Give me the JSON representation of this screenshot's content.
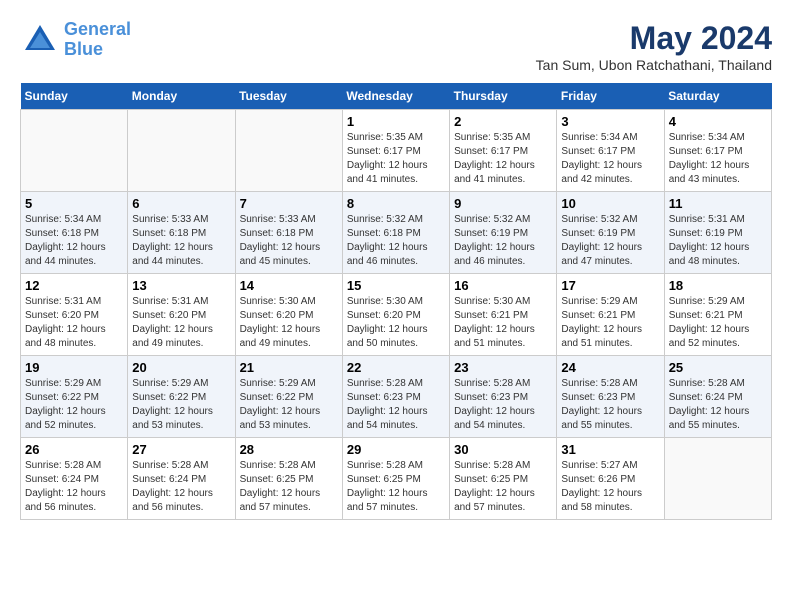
{
  "header": {
    "logo_line1": "General",
    "logo_line2": "Blue",
    "title": "May 2024",
    "subtitle": "Tan Sum, Ubon Ratchathani, Thailand"
  },
  "weekdays": [
    "Sunday",
    "Monday",
    "Tuesday",
    "Wednesday",
    "Thursday",
    "Friday",
    "Saturday"
  ],
  "weeks": [
    [
      {
        "day": "",
        "info": ""
      },
      {
        "day": "",
        "info": ""
      },
      {
        "day": "",
        "info": ""
      },
      {
        "day": "1",
        "info": "Sunrise: 5:35 AM\nSunset: 6:17 PM\nDaylight: 12 hours\nand 41 minutes."
      },
      {
        "day": "2",
        "info": "Sunrise: 5:35 AM\nSunset: 6:17 PM\nDaylight: 12 hours\nand 41 minutes."
      },
      {
        "day": "3",
        "info": "Sunrise: 5:34 AM\nSunset: 6:17 PM\nDaylight: 12 hours\nand 42 minutes."
      },
      {
        "day": "4",
        "info": "Sunrise: 5:34 AM\nSunset: 6:17 PM\nDaylight: 12 hours\nand 43 minutes."
      }
    ],
    [
      {
        "day": "5",
        "info": "Sunrise: 5:34 AM\nSunset: 6:18 PM\nDaylight: 12 hours\nand 44 minutes."
      },
      {
        "day": "6",
        "info": "Sunrise: 5:33 AM\nSunset: 6:18 PM\nDaylight: 12 hours\nand 44 minutes."
      },
      {
        "day": "7",
        "info": "Sunrise: 5:33 AM\nSunset: 6:18 PM\nDaylight: 12 hours\nand 45 minutes."
      },
      {
        "day": "8",
        "info": "Sunrise: 5:32 AM\nSunset: 6:18 PM\nDaylight: 12 hours\nand 46 minutes."
      },
      {
        "day": "9",
        "info": "Sunrise: 5:32 AM\nSunset: 6:19 PM\nDaylight: 12 hours\nand 46 minutes."
      },
      {
        "day": "10",
        "info": "Sunrise: 5:32 AM\nSunset: 6:19 PM\nDaylight: 12 hours\nand 47 minutes."
      },
      {
        "day": "11",
        "info": "Sunrise: 5:31 AM\nSunset: 6:19 PM\nDaylight: 12 hours\nand 48 minutes."
      }
    ],
    [
      {
        "day": "12",
        "info": "Sunrise: 5:31 AM\nSunset: 6:20 PM\nDaylight: 12 hours\nand 48 minutes."
      },
      {
        "day": "13",
        "info": "Sunrise: 5:31 AM\nSunset: 6:20 PM\nDaylight: 12 hours\nand 49 minutes."
      },
      {
        "day": "14",
        "info": "Sunrise: 5:30 AM\nSunset: 6:20 PM\nDaylight: 12 hours\nand 49 minutes."
      },
      {
        "day": "15",
        "info": "Sunrise: 5:30 AM\nSunset: 6:20 PM\nDaylight: 12 hours\nand 50 minutes."
      },
      {
        "day": "16",
        "info": "Sunrise: 5:30 AM\nSunset: 6:21 PM\nDaylight: 12 hours\nand 51 minutes."
      },
      {
        "day": "17",
        "info": "Sunrise: 5:29 AM\nSunset: 6:21 PM\nDaylight: 12 hours\nand 51 minutes."
      },
      {
        "day": "18",
        "info": "Sunrise: 5:29 AM\nSunset: 6:21 PM\nDaylight: 12 hours\nand 52 minutes."
      }
    ],
    [
      {
        "day": "19",
        "info": "Sunrise: 5:29 AM\nSunset: 6:22 PM\nDaylight: 12 hours\nand 52 minutes."
      },
      {
        "day": "20",
        "info": "Sunrise: 5:29 AM\nSunset: 6:22 PM\nDaylight: 12 hours\nand 53 minutes."
      },
      {
        "day": "21",
        "info": "Sunrise: 5:29 AM\nSunset: 6:22 PM\nDaylight: 12 hours\nand 53 minutes."
      },
      {
        "day": "22",
        "info": "Sunrise: 5:28 AM\nSunset: 6:23 PM\nDaylight: 12 hours\nand 54 minutes."
      },
      {
        "day": "23",
        "info": "Sunrise: 5:28 AM\nSunset: 6:23 PM\nDaylight: 12 hours\nand 54 minutes."
      },
      {
        "day": "24",
        "info": "Sunrise: 5:28 AM\nSunset: 6:23 PM\nDaylight: 12 hours\nand 55 minutes."
      },
      {
        "day": "25",
        "info": "Sunrise: 5:28 AM\nSunset: 6:24 PM\nDaylight: 12 hours\nand 55 minutes."
      }
    ],
    [
      {
        "day": "26",
        "info": "Sunrise: 5:28 AM\nSunset: 6:24 PM\nDaylight: 12 hours\nand 56 minutes."
      },
      {
        "day": "27",
        "info": "Sunrise: 5:28 AM\nSunset: 6:24 PM\nDaylight: 12 hours\nand 56 minutes."
      },
      {
        "day": "28",
        "info": "Sunrise: 5:28 AM\nSunset: 6:25 PM\nDaylight: 12 hours\nand 57 minutes."
      },
      {
        "day": "29",
        "info": "Sunrise: 5:28 AM\nSunset: 6:25 PM\nDaylight: 12 hours\nand 57 minutes."
      },
      {
        "day": "30",
        "info": "Sunrise: 5:28 AM\nSunset: 6:25 PM\nDaylight: 12 hours\nand 57 minutes."
      },
      {
        "day": "31",
        "info": "Sunrise: 5:27 AM\nSunset: 6:26 PM\nDaylight: 12 hours\nand 58 minutes."
      },
      {
        "day": "",
        "info": ""
      }
    ]
  ]
}
